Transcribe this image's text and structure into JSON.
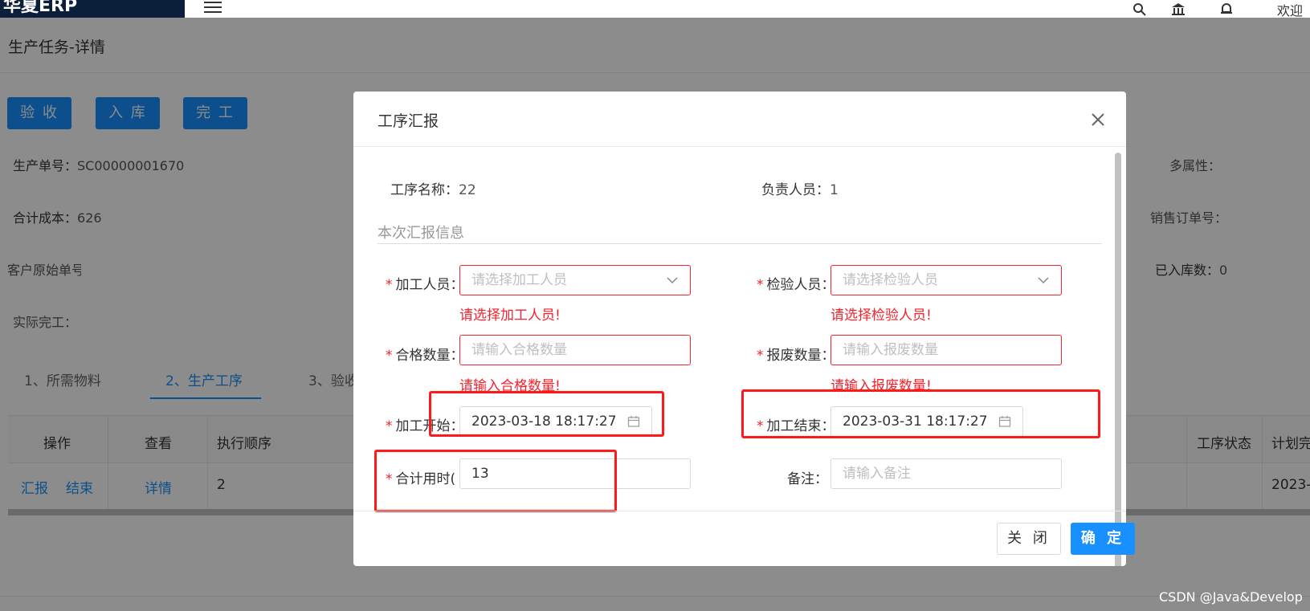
{
  "app": {
    "logo_text": "华夏ERP",
    "welcome": "欢迎"
  },
  "page": {
    "title": "生产任务-详情"
  },
  "actions": {
    "accept": "验 收",
    "stock_in": "入 库",
    "complete": "完 工"
  },
  "info": {
    "order_no_label": "生产单号：",
    "order_no": "SC00000001670",
    "total_cost_label": "合计成本：",
    "total_cost": "626",
    "customer_order_label": "客户原始单号",
    "actual_finish_label": "实际完工：",
    "multi_attr_label": "多属性：",
    "sales_order_label": "销售订单号：",
    "stocked_label": "已入库数：",
    "stocked": "0"
  },
  "tabs": [
    "1、所需物料",
    "2、生产工序",
    "3、验收"
  ],
  "table": {
    "headers": [
      "操作",
      "查看",
      "执行顺序",
      "工序状态",
      "计划完"
    ],
    "row": {
      "report": "汇报",
      "finish": "结束",
      "detail": "详情",
      "order": "2",
      "plan": "2023-0"
    }
  },
  "modal": {
    "title": "工序汇报",
    "process_name_label": "工序名称：",
    "process_name": "22",
    "owner_label": "负责人员：",
    "owner": "1",
    "section_title": "本次汇报信息",
    "fields": {
      "worker": {
        "label": "加工人员：",
        "placeholder": "请选择加工人员",
        "error": "请选择加工人员!"
      },
      "inspector": {
        "label": "检验人员：",
        "placeholder": "请选择检验人员",
        "error": "请选择检验人员!"
      },
      "qualified": {
        "label": "合格数量：",
        "placeholder": "请输入合格数量",
        "error": "请输入合格数量!"
      },
      "scrap": {
        "label": "报废数量：",
        "placeholder": "请输入报废数量",
        "error": "请输入报废数量!"
      },
      "start": {
        "label": "加工开始：",
        "value": "2023-03-18 18:17:27"
      },
      "end": {
        "label": "加工结束：",
        "value": "2023-03-31 18:17:27"
      },
      "total_time": {
        "label": "合计用时(",
        "value": "13"
      },
      "remark": {
        "label": "备注：",
        "placeholder": "请输入备注"
      }
    },
    "close_label": "关 闭",
    "ok_label": "确 定"
  },
  "watermark": "CSDN @Java&Develop",
  "colors": {
    "primary": "#1890ff",
    "error": "#f5222d",
    "highlight": "#ff1a1a"
  }
}
